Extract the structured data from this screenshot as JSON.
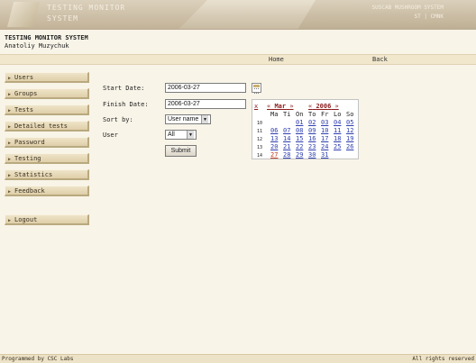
{
  "banner": {
    "title_line1": "TESTING MONITOR",
    "title_line2": "SYSTEM",
    "right_line1": "SUSCAB MUSHROOM SYSTEM",
    "right_line2": "ST | CMNK"
  },
  "header": {
    "system_title": "TESTING MONITOR SYSTEM",
    "user_name": "Anatoliy Muzychuk"
  },
  "nav": {
    "home": "Home",
    "back": "Back"
  },
  "menu": {
    "items": [
      {
        "label": "Users"
      },
      {
        "label": "Groups"
      },
      {
        "label": "Tests"
      },
      {
        "label": "Detailed tests"
      },
      {
        "label": "Password"
      },
      {
        "label": "Testing"
      },
      {
        "label": "Statistics"
      },
      {
        "label": "Feedback"
      }
    ],
    "logout": "Logout"
  },
  "form": {
    "start_date_label": "Start Date:",
    "start_date_value": "2006-03-27",
    "finish_date_label": "Finish Date:",
    "finish_date_value": "2006-03-27",
    "sort_by_label": "Sort by:",
    "sort_by_value": "User name",
    "user_label": "User",
    "user_value": "All",
    "submit_label": "Submit"
  },
  "calendar": {
    "close": "x",
    "month_prev": "«",
    "month": "Mar",
    "month_next": "»",
    "year_prev": "«",
    "year": "2006",
    "year_next": "»",
    "weekdays": [
      "Ma",
      "Ti",
      "On",
      "To",
      "Fr",
      "Lo",
      "So"
    ],
    "weeks": [
      {
        "week": "10",
        "days": [
          "",
          "",
          "01",
          "02",
          "03",
          "04",
          "05"
        ]
      },
      {
        "week": "11",
        "days": [
          "06",
          "07",
          "08",
          "09",
          "10",
          "11",
          "12"
        ]
      },
      {
        "week": "12",
        "days": [
          "13",
          "14",
          "15",
          "16",
          "17",
          "18",
          "19"
        ]
      },
      {
        "week": "13",
        "days": [
          "20",
          "21",
          "22",
          "23",
          "24",
          "25",
          "26"
        ]
      },
      {
        "week": "14",
        "days": [
          "27",
          "28",
          "29",
          "30",
          "31",
          "",
          ""
        ]
      }
    ],
    "today": "27"
  },
  "footer": {
    "left": "Programmed by CSC Labs",
    "right": "All rights reserved"
  },
  "colors": {
    "background": "#f8f4e8",
    "menu_button": "#dfcfa9",
    "calendar_link": "#2f3fae",
    "calendar_header": "#8b1a1a",
    "today": "#c43a1e"
  }
}
